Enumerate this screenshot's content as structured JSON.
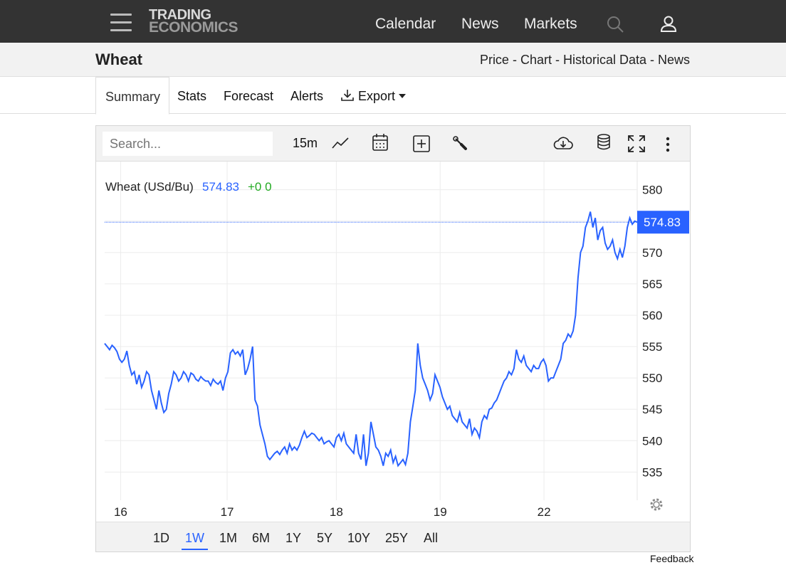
{
  "header": {
    "logo_line1": "TRADING",
    "logo_line2": "ECONOMICS",
    "nav": [
      "Calendar",
      "News",
      "Markets"
    ],
    "icons": [
      "menu-icon",
      "search-icon",
      "user-icon"
    ]
  },
  "titlebar": {
    "title": "Wheat",
    "crumbs": "Price - Chart - Historical Data - News"
  },
  "tabs": {
    "active": "Summary",
    "items": [
      "Stats",
      "Forecast",
      "Alerts"
    ],
    "export_label": "Export"
  },
  "chart_toolbar": {
    "search_placeholder": "Search...",
    "interval": "15m"
  },
  "legend": {
    "name": "Wheat (USd/Bu)",
    "price": "574.83",
    "change": "+0 0"
  },
  "range": {
    "buttons": [
      "1D",
      "1W",
      "1M",
      "6M",
      "1Y",
      "5Y",
      "10Y",
      "25Y",
      "All"
    ],
    "active": "1W"
  },
  "feedback_label": "Feedback",
  "colors": {
    "line": "#2962ff",
    "up": "#22aa22",
    "topbar": "#333333"
  },
  "chart_data": {
    "type": "line",
    "series": [
      {
        "name": "Wheat (USd/Bu)",
        "values": [
          555.5,
          555,
          554.5,
          555.2,
          554.8,
          554.2,
          553,
          552.5,
          553,
          554.3,
          552,
          550.5,
          551,
          549,
          550.5,
          548.5,
          549.5,
          551,
          550.5,
          548,
          546.5,
          545,
          548,
          546,
          544.5,
          545,
          547.5,
          549,
          551,
          550.5,
          549.5,
          550,
          551,
          550.5,
          549.5,
          550.8,
          550.5,
          549.8,
          549.5,
          550.2,
          549.8,
          549.5,
          549.5,
          548.8,
          549.8,
          549.3,
          549,
          549.5,
          548,
          550,
          551,
          554,
          554.5,
          553.8,
          554.2,
          553.5,
          554.5,
          550.5,
          551.5,
          553,
          555,
          546.5,
          545.5,
          542.5,
          541,
          539.5,
          537.5,
          537,
          537.5,
          538,
          538.3,
          537.8,
          538.5,
          539,
          538,
          539.5,
          538.5,
          539,
          538.5,
          539.3,
          540.5,
          541.5,
          540.5,
          540.8,
          541.2,
          541,
          540.5,
          540,
          540.5,
          539.5,
          539.8,
          540,
          539.5,
          539,
          540.5,
          541,
          540,
          541.2,
          539.5,
          539,
          538.5,
          538,
          541,
          538,
          537,
          541,
          536,
          538,
          543,
          541,
          539,
          538.5,
          537.5,
          536,
          538,
          537.5,
          538.5,
          536.5,
          537.5,
          536,
          536.5,
          537,
          536.2,
          538,
          543,
          545.5,
          548,
          555.5,
          552,
          550,
          549,
          548,
          546.5,
          547.5,
          550.5,
          549.5,
          548.5,
          547,
          546,
          545,
          545.5,
          544,
          543.5,
          543,
          544.5,
          543,
          542.5,
          542,
          543.5,
          541,
          542,
          541.5,
          540.5,
          543,
          544,
          543.5,
          545,
          545.2,
          546,
          546.5,
          547.5,
          548.5,
          549.5,
          550,
          551,
          550.5,
          551.5,
          554.5,
          553,
          552.5,
          553.5,
          552,
          551.5,
          551,
          552,
          551.5,
          551.5,
          552.5,
          553,
          552,
          549.5,
          550,
          550,
          551,
          552,
          553,
          555.5,
          556,
          557,
          556.5,
          557.5,
          560,
          566,
          570,
          571,
          574,
          575,
          576.5,
          574,
          575.5,
          572,
          573.5,
          574,
          571.5,
          570.5,
          571,
          572,
          570,
          569,
          570.5,
          569.2,
          571,
          574,
          575.5,
          574.5,
          575,
          574.83
        ]
      }
    ],
    "x_labels": [
      "16",
      "17",
      "18",
      "19",
      "22"
    ],
    "y_ticks": [
      535,
      540,
      545,
      550,
      555,
      560,
      565,
      570,
      575,
      580
    ],
    "y_tick_labels": [
      "535",
      "540",
      "545",
      "550",
      "555",
      "560",
      "565",
      "570",
      "580"
    ],
    "last_price_label": "574.83",
    "last_price": 574.83,
    "ylim": [
      530.5,
      584.5
    ],
    "grid": true,
    "legend_position": "top-left"
  }
}
